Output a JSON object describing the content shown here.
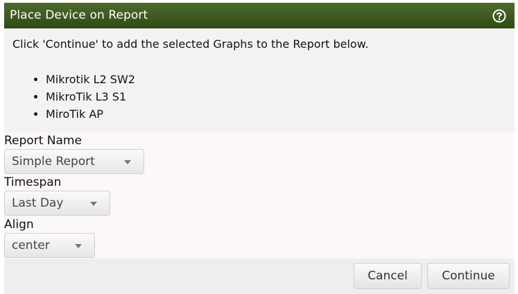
{
  "dialog": {
    "title": "Place Device on Report",
    "help_icon": "question-circle-icon",
    "message": "Click 'Continue' to add the selected Graphs to the Report below.",
    "devices": [
      "Mikrotik L2 SW2",
      "MikroTik L3 S1",
      "MiroTik AP"
    ]
  },
  "form": {
    "report_name": {
      "label": "Report Name",
      "value": "Simple Report"
    },
    "timespan": {
      "label": "Timespan",
      "value": "Last Day"
    },
    "align": {
      "label": "Align",
      "value": "center"
    }
  },
  "buttons": {
    "cancel": "Cancel",
    "continue": "Continue"
  },
  "colors": {
    "titlebar": "#3e5b22",
    "content_bg": "#f3f3f3",
    "form_bg": "#fcf8f7",
    "footer_bg": "#eeeeee"
  }
}
